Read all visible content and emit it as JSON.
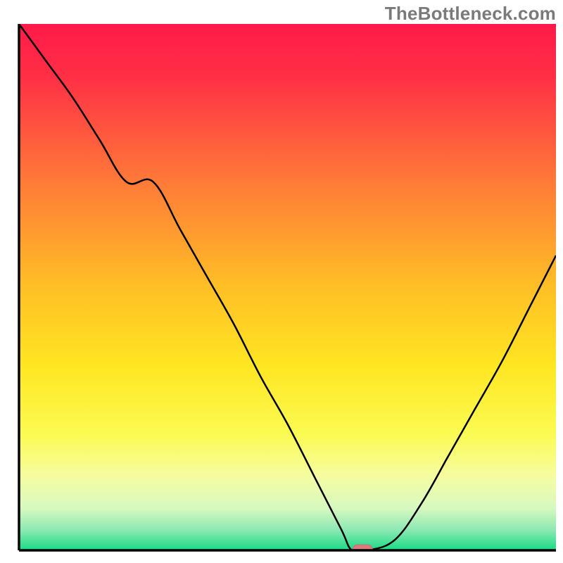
{
  "watermark": "TheBottleneck.com",
  "chart_data": {
    "type": "line",
    "title": "",
    "xlabel": "",
    "ylabel": "",
    "xlim": [
      0,
      100
    ],
    "ylim": [
      0,
      100
    ],
    "x": [
      0,
      5,
      10,
      15,
      20,
      25,
      30,
      35,
      40,
      45,
      50,
      55,
      60,
      62,
      65,
      70,
      75,
      80,
      85,
      90,
      95,
      100
    ],
    "values": [
      100,
      93,
      86,
      78,
      70,
      70,
      61,
      52,
      43,
      33,
      24,
      14,
      4,
      0,
      0,
      2,
      9,
      18,
      27,
      36,
      46,
      56
    ],
    "optimal_point": {
      "x": 64,
      "y": 0
    },
    "colors": {
      "gradient_stops": [
        {
          "offset": 0.0,
          "color": "#ff1a49"
        },
        {
          "offset": 0.1,
          "color": "#ff2f46"
        },
        {
          "offset": 0.3,
          "color": "#ff7a38"
        },
        {
          "offset": 0.5,
          "color": "#ffbf26"
        },
        {
          "offset": 0.65,
          "color": "#ffe622"
        },
        {
          "offset": 0.78,
          "color": "#fbfb53"
        },
        {
          "offset": 0.86,
          "color": "#f5fca2"
        },
        {
          "offset": 0.92,
          "color": "#d7f9c0"
        },
        {
          "offset": 0.96,
          "color": "#8fe9b3"
        },
        {
          "offset": 1.0,
          "color": "#19da86"
        }
      ],
      "axis": "#000000",
      "marker_fill": "#d97b7e",
      "marker_stroke": "#c86c73"
    },
    "grid": false,
    "legend": null
  }
}
